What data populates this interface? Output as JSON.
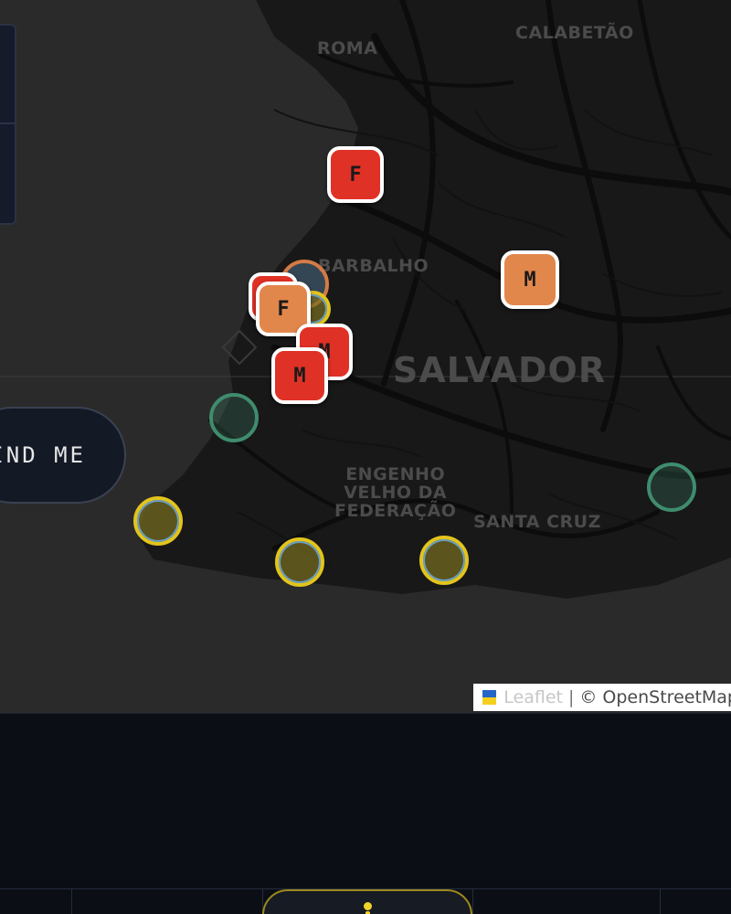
{
  "map": {
    "labels": {
      "roma": "ROMA",
      "calabetao": "CALABETÃO",
      "barbalho": "BARBALHO",
      "salvador": "SALVADOR",
      "engenho": "ENGENHO\nVELHO DA\nFEDERAÇÃO",
      "santa_cruz": "SANTA CRUZ"
    },
    "markers": {
      "m1": "F",
      "m2": "M",
      "m3": "F",
      "m4": "M",
      "m5": "M"
    },
    "colors": {
      "water": "#2a2a2a",
      "land": "#181818",
      "road": "#0e0e0e",
      "marker_red": "#e03126",
      "marker_orange": "#e2874b",
      "ring_green": "#3f8c6e",
      "ring_yellow": "#e2c41c"
    }
  },
  "controls": {
    "find_me": "FIND ME"
  },
  "attribution": {
    "leaflet": "Leaflet",
    "separator": "|",
    "osm": "© OpenStreetMap"
  }
}
